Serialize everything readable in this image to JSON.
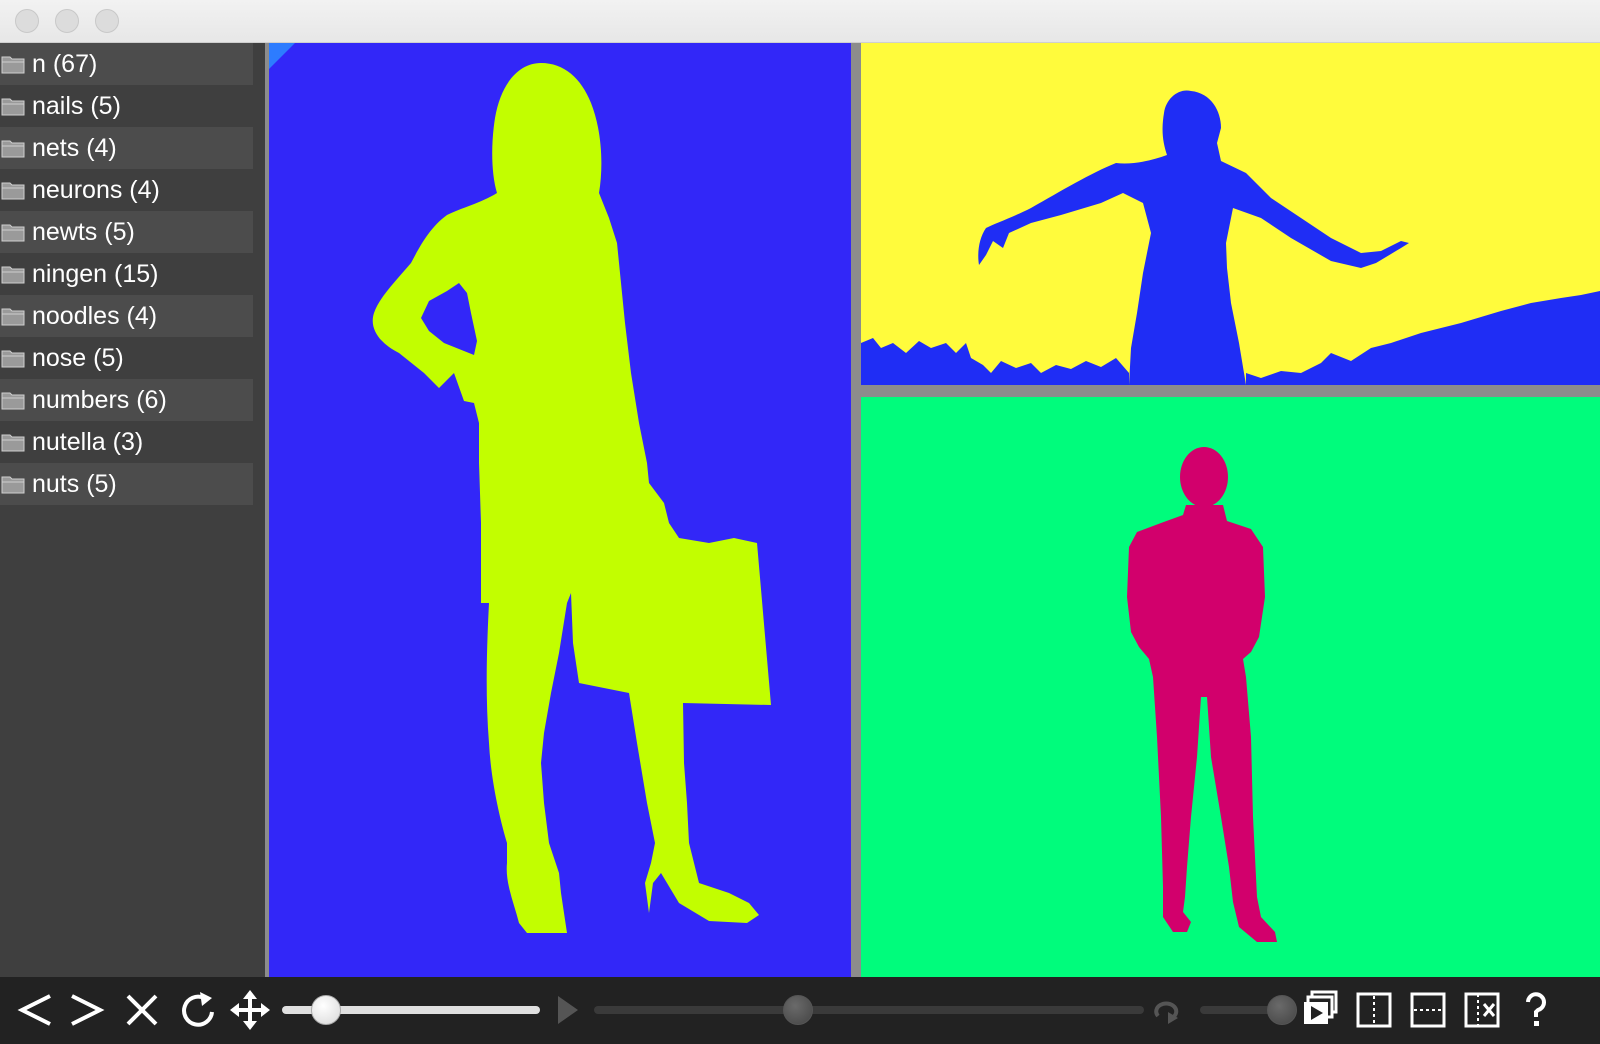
{
  "window": {
    "title": ""
  },
  "sidebar": {
    "items": [
      {
        "label": "n (67)"
      },
      {
        "label": "nails (5)"
      },
      {
        "label": "nets (4)"
      },
      {
        "label": "neurons (4)"
      },
      {
        "label": "newts (5)"
      },
      {
        "label": "ningen (15)"
      },
      {
        "label": "noodles (4)"
      },
      {
        "label": "nose (5)"
      },
      {
        "label": "numbers (6)"
      },
      {
        "label": "nutella (3)"
      },
      {
        "label": "nuts (5)"
      }
    ]
  },
  "panels": {
    "left": {
      "background": "#3227f8",
      "figure_color": "#c2fe00",
      "figure": "woman-with-briefcase-silhouette"
    },
    "top_right": {
      "background": "#fffb3c",
      "figure_color": "#1f2df5",
      "figure": "woman-arms-outstretched-silhouette"
    },
    "bottom_right": {
      "background": "#00fc7c",
      "figure_color": "#d2006c",
      "figure": "man-in-suit-silhouette"
    }
  },
  "toolbar": {
    "buttons": [
      {
        "icon": "previous-icon"
      },
      {
        "icon": "next-icon"
      },
      {
        "icon": "close-icon"
      },
      {
        "icon": "rotate-icon"
      },
      {
        "icon": "move-icon"
      },
      {
        "icon": "play-icon"
      },
      {
        "icon": "loop-icon"
      },
      {
        "icon": "slideshow-icon"
      },
      {
        "icon": "vertical-split-icon"
      },
      {
        "icon": "horizontal-split-icon"
      },
      {
        "icon": "close-split-icon"
      },
      {
        "icon": "help-icon"
      }
    ],
    "zoom_slider_value": 0.17,
    "progress_slider_value": 0.37,
    "speed_slider_value": 1.0
  }
}
